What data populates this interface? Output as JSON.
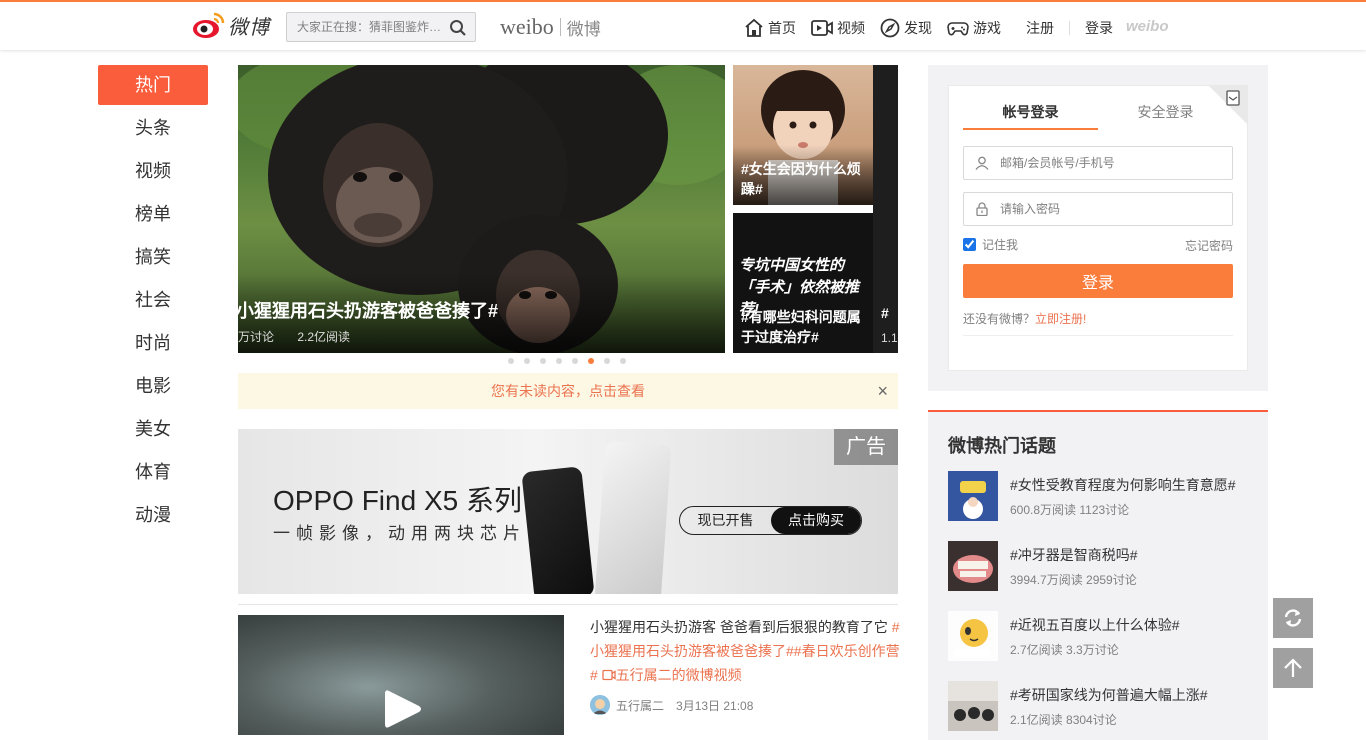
{
  "header": {
    "logo_text": "微博",
    "search_placeholder": "大家正在搜：猜菲图鉴炸…",
    "brand_en": "weibo",
    "brand_cn": "微博",
    "nav": [
      {
        "label": "首页",
        "icon": "home-icon"
      },
      {
        "label": "视频",
        "icon": "video-icon"
      },
      {
        "label": "发现",
        "icon": "compass-icon"
      },
      {
        "label": "游戏",
        "icon": "gamepad-icon"
      }
    ],
    "register": "注册",
    "login": "登录",
    "mini_logo": "weibo"
  },
  "sidebar": {
    "items": [
      "热门",
      "头条",
      "视频",
      "榜单",
      "搞笑",
      "社会",
      "时尚",
      "电影",
      "美女",
      "体育",
      "动漫"
    ]
  },
  "carousel": {
    "main": {
      "title": "小猩猩用石头扔游客被爸爸揍了#",
      "discuss": "万讨论",
      "reads": "2.2亿阅读"
    },
    "tile1": {
      "caption": "#女生会因为什么烦躁#"
    },
    "tile2": {
      "caption": "#有哪些妇科问题属于过度治疗#",
      "overlay": "专坑中国女性的「手术」依然被推荐!"
    },
    "edge": {
      "title": "#",
      "meta": "1.1"
    },
    "dot_count": 8,
    "active_dot": 5
  },
  "notice": {
    "text": "您有未读内容，点击查看",
    "close": "×"
  },
  "ad": {
    "tag": "广告",
    "title": "OPPO Find X5 系列",
    "subtitle": "一帧影像，动用两块芯片",
    "cta_left": "现已开售",
    "cta_right": "点击购买"
  },
  "feed": {
    "text": "小猩猩用石头扔游客 爸爸看到后狠狠的教育了它 ",
    "tag1": "#小猩猩用石头扔游客被爸爸揍了#",
    "tag2": "#春日欢乐创作营#",
    "video_link": "五行属二的微博视频",
    "author": "五行属二",
    "time": "3月13日 21:08"
  },
  "login": {
    "tab_account": "帐号登录",
    "tab_secure": "安全登录",
    "username_placeholder": "邮箱/会员帐号/手机号",
    "password_placeholder": "请输入密码",
    "remember": "记住我",
    "forgot": "忘记密码",
    "submit": "登录",
    "no_account": "还没有微博？",
    "register_link": "立即注册!"
  },
  "hot_topics": {
    "title": "微博热门话题",
    "items": [
      {
        "title": "#女性受教育程度为何影响生育意愿#",
        "meta": "600.8万阅读 1123讨论"
      },
      {
        "title": "#冲牙器是智商税吗#",
        "meta": "3994.7万阅读 2959讨论"
      },
      {
        "title": "#近视五百度以上什么体验#",
        "meta": "2.7亿阅读 3.3万讨论"
      },
      {
        "title": "#考研国家线为何普遍大幅上涨#",
        "meta": "2.1亿阅读 8304讨论"
      }
    ]
  },
  "colors": {
    "accent": "#fa7d3c",
    "active_red": "#fa5d3c",
    "link_orange": "#eb7350"
  }
}
